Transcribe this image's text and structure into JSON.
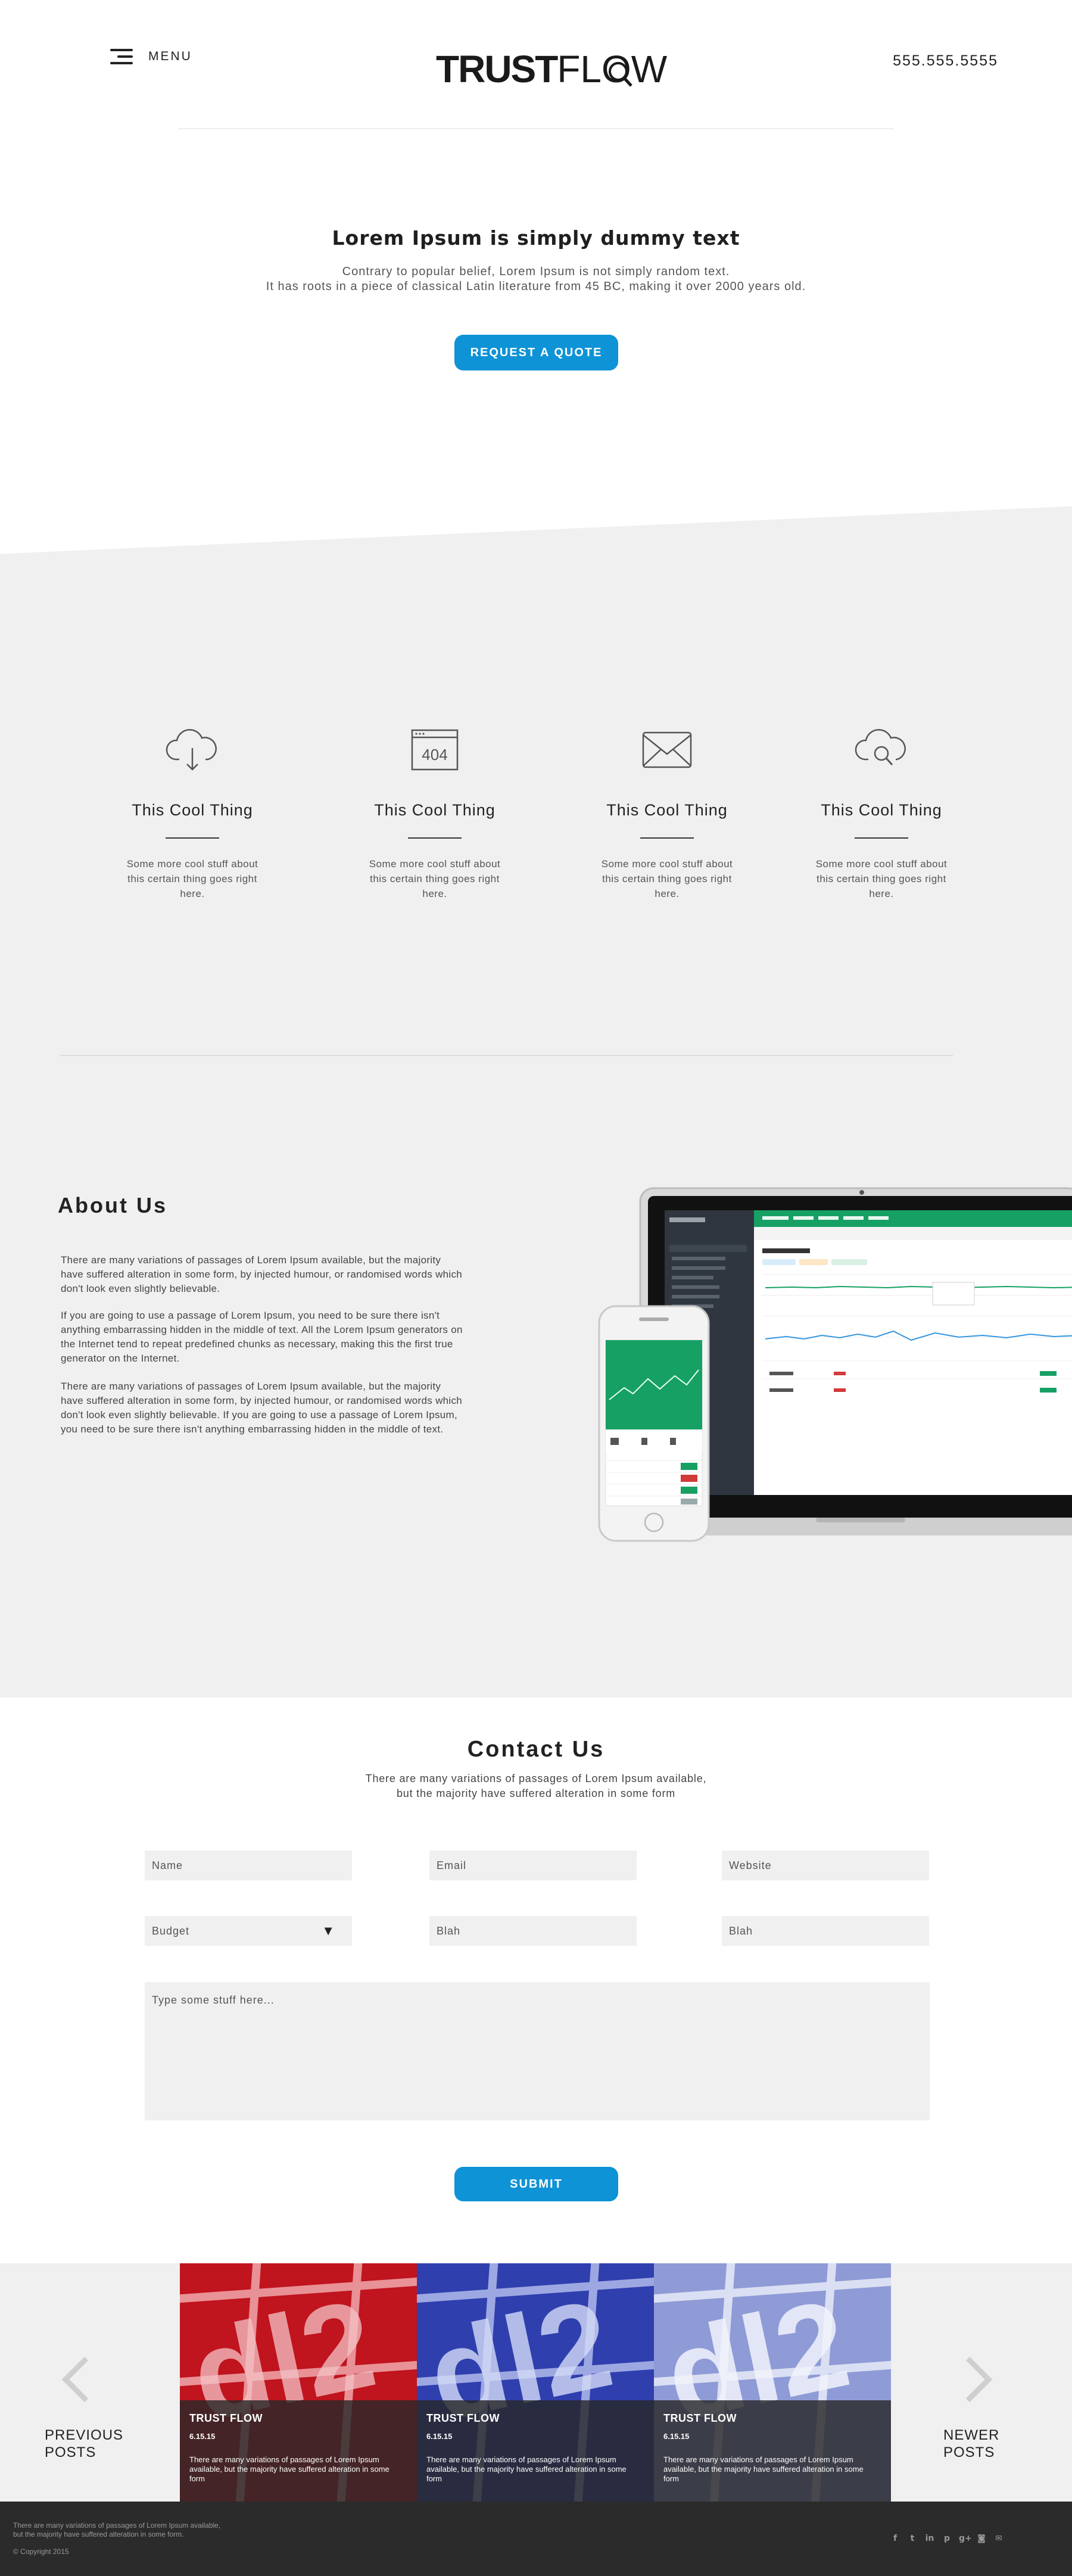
{
  "header": {
    "menu_label": "MENU",
    "logo_bold": "TRUST",
    "logo_thin": "FLOW",
    "phone": "555.555.5555"
  },
  "hero": {
    "title": "Lorem Ipsum is simply dummy text",
    "line1": "Contrary to popular belief, Lorem Ipsum is not simply random text.",
    "line2": "It has roots in a piece of classical Latin literature from 45 BC, making it over 2000 years old.",
    "cta": "REQUEST A QUOTE"
  },
  "features": [
    {
      "icon": "cloud-download-icon",
      "title": "This Cool Thing",
      "text": "Some more cool stuff about this certain thing goes right here."
    },
    {
      "icon": "404-page-icon",
      "title": "This Cool Thing",
      "text": "Some more cool stuff about this certain thing goes right here."
    },
    {
      "icon": "envelope-icon",
      "title": "This Cool Thing",
      "text": "Some more cool stuff about this certain thing goes right here."
    },
    {
      "icon": "cloud-search-icon",
      "title": "This Cool Thing",
      "text": "Some more cool stuff about this certain thing goes right here."
    }
  ],
  "about": {
    "title": "About Us",
    "p1": "There are many variations of passages of Lorem Ipsum available, but the majority have suffered alteration in some form, by injected humour, or randomised words which don't look even slightly believable.",
    "p2": "If you are going to use a passage of Lorem Ipsum, you need to be sure there isn't anything embarrassing hidden in the middle of text. All the Lorem Ipsum generators on the Internet tend to repeat predefined chunks as necessary, making this the first true generator on the Internet.",
    "p3": "There are many variations of passages of Lorem Ipsum available, but the majority have suffered alteration in some form, by injected humour, or randomised words which don't look even slightly believable. If you are going to use a passage of Lorem Ipsum, you need to be sure there isn't anything embarrassing hidden in the middle of text."
  },
  "contact": {
    "title": "Contact Us",
    "sub1": "There are many variations of passages of Lorem Ipsum available,",
    "sub2": "but the majority have suffered alteration in some form",
    "fields": {
      "name": "Name",
      "email": "Email",
      "website": "Website",
      "budget": "Budget",
      "blah1": "Blah",
      "blah2": "Blah",
      "message": "Type some stuff here..."
    },
    "submit": "SUBMIT"
  },
  "posts": {
    "prev_label_1": "PREVIOUS",
    "prev_label_2": "POSTS",
    "next_label_1": "NEWER",
    "next_label_2": "POSTS",
    "items": [
      {
        "title": "TRUST FLOW",
        "date": "6.15.15",
        "text": "There are many variations of passages of Lorem Ipsum available, but the majority have suffered alteration in some form",
        "tint": "#c0141e"
      },
      {
        "title": "TRUST FLOW",
        "date": "6.15.15",
        "text": "There are many variations of passages of Lorem Ipsum available, but the majority have suffered alteration in some form",
        "tint": "#2f3fae"
      },
      {
        "title": "TRUST FLOW",
        "date": "6.15.15",
        "text": "There are many variations of passages of Lorem Ipsum available, but the majority have suffered alteration in some form",
        "tint": "#8e9bd6"
      }
    ]
  },
  "footer": {
    "text1": "There are many variations of passages of Lorem Ipsum available,",
    "text2": "but the majority have suffered alteration in some form.",
    "copyright": "© Copyright 2015",
    "socials": [
      "facebook-icon",
      "twitter-icon",
      "linkedin-icon",
      "pinterest-icon",
      "google-plus-icon",
      "instagram-icon",
      "email-icon"
    ]
  },
  "colors": {
    "accent": "#0e93d6",
    "grey_bg": "#f0f0f0",
    "footer_bg": "#2b2b2b"
  }
}
